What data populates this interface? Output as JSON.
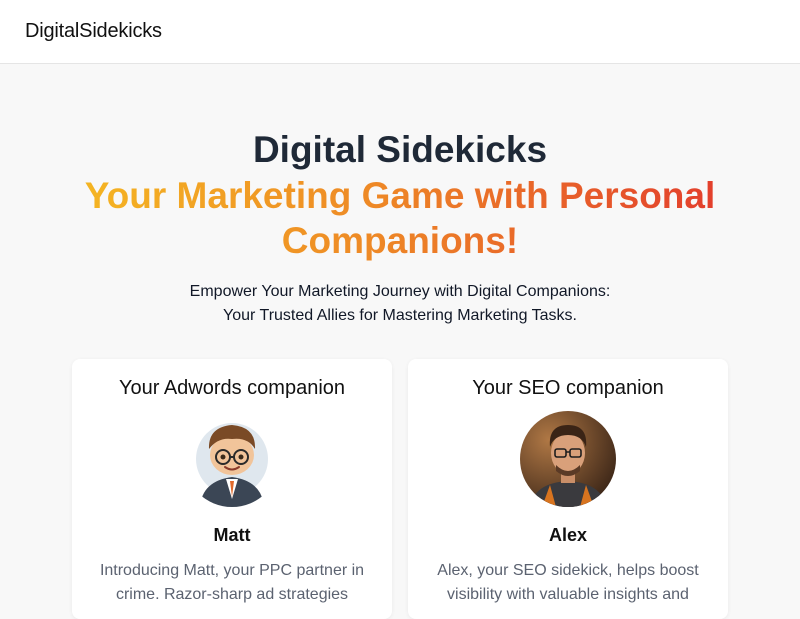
{
  "header": {
    "logo": "DigitalSidekicks"
  },
  "hero": {
    "title": "Digital Sidekicks",
    "subtitle": "Your Marketing Game with Personal Companions!",
    "tagline_line1": "Empower Your Marketing Journey with Digital Companions:",
    "tagline_line2": "Your Trusted Allies for Mastering Marketing Tasks."
  },
  "companions": [
    {
      "heading": "Your Adwords companion",
      "name": "Matt",
      "description": "Introducing Matt, your PPC partner in crime. Razor-sharp ad strategies"
    },
    {
      "heading": "Your SEO companion",
      "name": "Alex",
      "description": "Alex, your SEO sidekick, helps boost visibility with valuable insights and"
    }
  ],
  "colors": {
    "gradient_start": "#f5b822",
    "gradient_mid": "#ee8a26",
    "gradient_end": "#e23a2d",
    "title": "#1f2937"
  }
}
